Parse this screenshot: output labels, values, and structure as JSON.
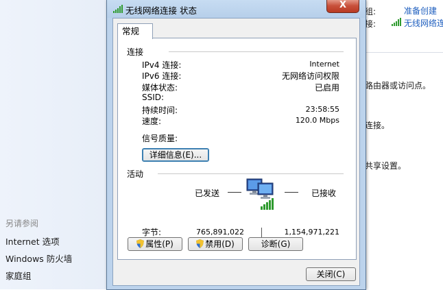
{
  "dialog": {
    "title": "无线网络连接 状态",
    "close_label": "X",
    "tab": "常规",
    "connection": {
      "header": "连接",
      "rows": [
        {
          "key": "IPv4 连接:",
          "value": "Internet"
        },
        {
          "key": "IPv6 连接:",
          "value": "无网络访问权限"
        },
        {
          "key": "媒体状态:",
          "value": "已启用"
        },
        {
          "key": "SSID:",
          "value": ""
        },
        {
          "key": "持续时间:",
          "value": "23:58:55"
        },
        {
          "key": "速度:",
          "value": "120.0 Mbps"
        }
      ],
      "signal_label": "信号质量:",
      "details_button": "详细信息(E)..."
    },
    "activity": {
      "header": "活动",
      "sent_label": "已发送",
      "received_label": "已接收",
      "bytes_label": "字节:",
      "bytes_sent": "765,891,022",
      "bytes_received": "1,154,971,221"
    },
    "buttons": {
      "properties": "属性(P)",
      "disable": "禁用(D)",
      "diagnose": "诊断(G)",
      "close": "关闭(C)"
    }
  },
  "background": {
    "see_also_header": "另请参阅",
    "see_also_links": [
      "Internet 选项",
      "Windows 防火墙",
      "家庭组"
    ],
    "right_text_1": "组:",
    "right_link_1": "准备创建",
    "right_text_2": "接:",
    "right_link_2": "无线网络连",
    "right_text_3": "路由器或访问点。",
    "right_text_4": "连接。",
    "right_text_5": "共享设置。"
  },
  "colors": {
    "title_bar": "#bcd3ec",
    "close_button": "#c8503a",
    "link": "#1f5fbf"
  }
}
